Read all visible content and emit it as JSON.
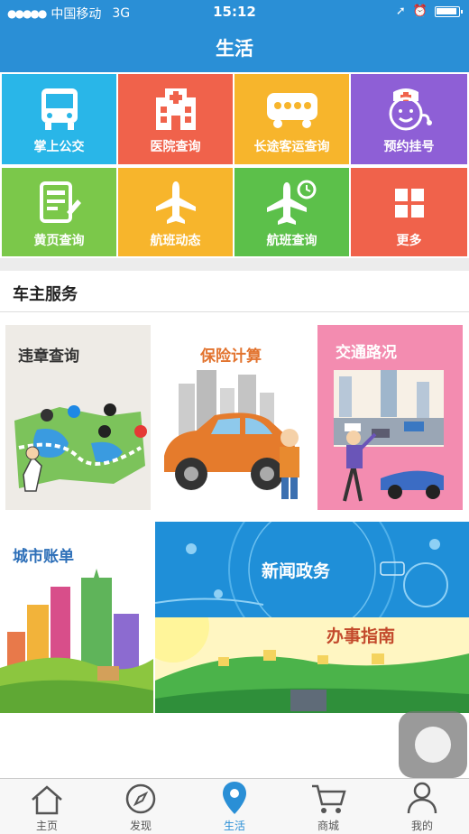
{
  "status_bar": {
    "carrier": "中国移动",
    "network": "3G",
    "time": "15:12"
  },
  "header": {
    "title": "生活"
  },
  "tiles": [
    {
      "label": "掌上公交",
      "icon": "bus-icon",
      "color": "#29b6e8"
    },
    {
      "label": "医院查询",
      "icon": "hospital-icon",
      "color": "#f0624b"
    },
    {
      "label": "长途客运查询",
      "icon": "coach-icon",
      "color": "#f7b52c"
    },
    {
      "label": "预约挂号",
      "icon": "nurse-icon",
      "color": "#8e5fd6"
    },
    {
      "label": "黄页查询",
      "icon": "yellow-pages-icon",
      "color": "#7bc84a"
    },
    {
      "label": "航班动态",
      "icon": "airplane-icon",
      "color": "#f7b52c"
    },
    {
      "label": "航班查询",
      "icon": "airplane-clock-icon",
      "color": "#5cc04a"
    },
    {
      "label": "更多",
      "icon": "grid-more-icon",
      "color": "#f0624b"
    }
  ],
  "section": {
    "title": "车主服务"
  },
  "cards": {
    "violation": "违章查询",
    "insurance": "保险计算",
    "traffic": "交通路况",
    "city_bill": "城市账单",
    "news": "新闻政务",
    "guide": "办事指南"
  },
  "tabbar": {
    "items": [
      {
        "label": "主页",
        "icon": "home-icon"
      },
      {
        "label": "发现",
        "icon": "compass-icon"
      },
      {
        "label": "生活",
        "icon": "location-pin-icon"
      },
      {
        "label": "商城",
        "icon": "cart-icon"
      },
      {
        "label": "我的",
        "icon": "user-icon"
      }
    ],
    "active_color": "#2a8fd6"
  }
}
